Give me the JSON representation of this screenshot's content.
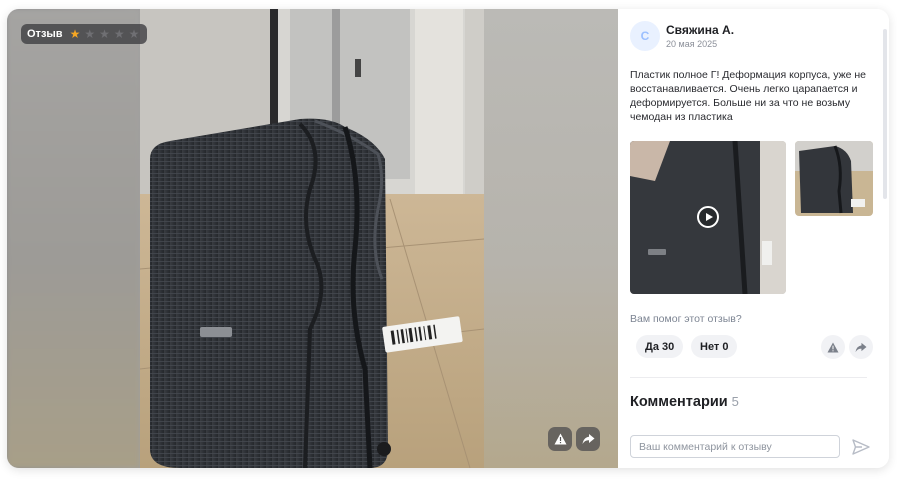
{
  "badge": {
    "label": "Отзыв",
    "rating": 1,
    "max_rating": 5,
    "star_filled_color": "#f5a623",
    "star_empty_color": "#7a7a7e"
  },
  "media": {
    "main_image": "suitcase-photo",
    "complain_icon": "warning-icon",
    "share_icon": "share-arrow-icon"
  },
  "review": {
    "avatar_letter": "С",
    "author": "Свяжина А.",
    "date": "20 мая 2025",
    "text": "Пластик полное Г! Деформация корпуса, уже не восстанавливается. Очень легко царапается и деформируется. Больше ни за что не возьму чемодан из пластика",
    "attachments": [
      {
        "type": "video",
        "icon": "play-icon"
      },
      {
        "type": "image"
      }
    ]
  },
  "feedback": {
    "question": "Вам помог этот отзыв?",
    "yes_label": "Да 30",
    "no_label": "Нет 0",
    "complain_icon": "warning-icon",
    "share_icon": "share-arrow-icon"
  },
  "comments": {
    "title": "Комментарии",
    "count": "5",
    "input_placeholder": "Ваш комментарий к отзыву",
    "input_value": "",
    "send_icon": "send-icon"
  },
  "colors": {
    "accent": "#005bff",
    "pill_bg": "#f1f2f5",
    "muted_text": "#7d8593"
  }
}
